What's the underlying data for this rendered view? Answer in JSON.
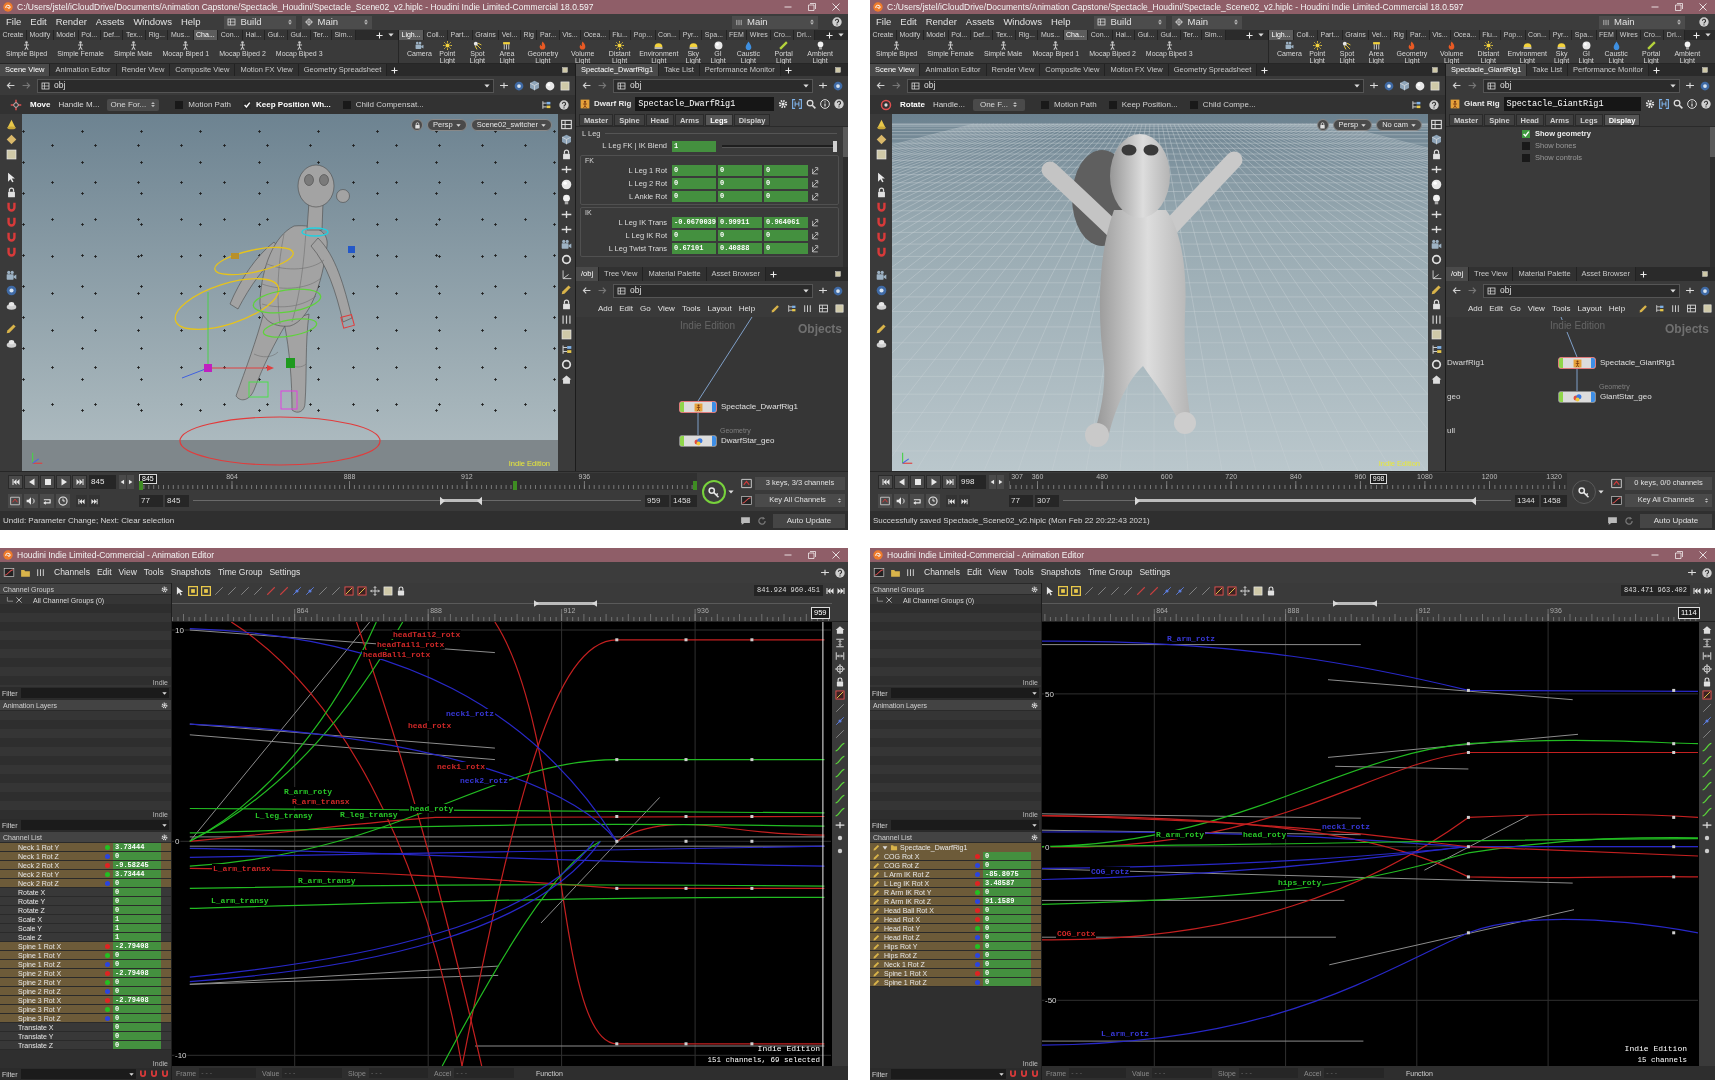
{
  "windows": [
    {
      "kind": "main",
      "title": "C:/Users/jstel/iCloudDrive/Documents/Animation Capstone/Spectacle_Houdini/Spectacle_Scene02_v2.hiplc - Houdini Indie Limited-Commercial 18.0.597",
      "menu": [
        "File",
        "Edit",
        "Render",
        "Assets",
        "Windows",
        "Help"
      ],
      "desk": "Build",
      "desktop": "Main",
      "right_desktop": "Main",
      "shelf_tabs_left": [
        {
          "label": "Create",
          "selected": false
        },
        {
          "label": "Modify",
          "selected": false
        },
        {
          "label": "Model",
          "selected": false
        },
        {
          "label": "Pol...",
          "selected": false
        },
        {
          "label": "Def...",
          "selected": false
        },
        {
          "label": "Tex...",
          "selected": false
        },
        {
          "label": "Rig...",
          "selected": false
        },
        {
          "label": "Mus...",
          "selected": false
        },
        {
          "label": "Cha...",
          "selected": true
        },
        {
          "label": "Con...",
          "selected": false
        },
        {
          "label": "Hai...",
          "selected": false
        },
        {
          "label": "Gui...",
          "selected": false
        },
        {
          "label": "Gui...",
          "selected": false
        },
        {
          "label": "Ter...",
          "selected": false
        },
        {
          "label": "Sim...",
          "selected": false
        }
      ],
      "shelf_tabs_right": [
        {
          "label": "Ligh...",
          "selected": true
        },
        {
          "label": "Coll...",
          "selected": false
        },
        {
          "label": "Part...",
          "selected": false
        },
        {
          "label": "Grains",
          "selected": false
        },
        {
          "label": "Vel...",
          "selected": false
        },
        {
          "label": "Rig",
          "selected": false
        },
        {
          "label": "Par...",
          "selected": false
        },
        {
          "label": "Vis...",
          "selected": false
        },
        {
          "label": "Ocea...",
          "selected": false
        },
        {
          "label": "Flu...",
          "selected": false
        },
        {
          "label": "Pop...",
          "selected": false
        },
        {
          "label": "Con...",
          "selected": false
        },
        {
          "label": "Pyr...",
          "selected": false
        },
        {
          "label": "Spa...",
          "selected": false
        },
        {
          "label": "FEM",
          "selected": false
        },
        {
          "label": "Wires",
          "selected": false
        },
        {
          "label": "Cro...",
          "selected": false
        },
        {
          "label": "Dri...",
          "selected": false
        }
      ],
      "shelf_tools_left": [
        {
          "label": "Simple Biped",
          "kind": "biped"
        },
        {
          "label": "Simple Female",
          "kind": "biped"
        },
        {
          "label": "Simple Male",
          "kind": "biped"
        },
        {
          "label": "Mocap Biped 1",
          "kind": "biped"
        },
        {
          "label": "Mocap Biped 2",
          "kind": "biped"
        },
        {
          "label": "Mocap Biped 3",
          "kind": "biped"
        }
      ],
      "shelf_tools_right": [
        {
          "label": "Camera",
          "kind": "camera"
        },
        {
          "label": "Point Light",
          "kind": "point_light"
        },
        {
          "label": "Spot Light",
          "kind": "spot_light"
        },
        {
          "label": "Area Light",
          "kind": "area_light"
        },
        {
          "label": "Geometry Light",
          "kind": "geometry_light"
        },
        {
          "label": "Volume Light",
          "kind": "volume_light"
        },
        {
          "label": "Distant Light",
          "kind": "distant_light"
        },
        {
          "label": "Environment Light",
          "kind": "environment_light"
        },
        {
          "label": "Sky Light",
          "kind": "sky_light"
        },
        {
          "label": "GI Light",
          "kind": "gi_light"
        },
        {
          "label": "Caustic Light",
          "kind": "caustic_light"
        },
        {
          "label": "Portal Light",
          "kind": "portal_light"
        },
        {
          "label": "Ambient Light",
          "kind": "ambient_light"
        }
      ],
      "view_tabs": [
        {
          "label": "Scene View",
          "selected": true
        },
        {
          "label": "Animation Editor",
          "selected": false
        },
        {
          "label": "Render View",
          "selected": false
        },
        {
          "label": "Composite View",
          "selected": false
        },
        {
          "label": "Motion FX View",
          "selected": false
        },
        {
          "label": "Geometry Spreadsheet",
          "selected": false
        }
      ],
      "param_tabs": [
        {
          "label": "Spectacle_DwarfRig1",
          "selected": true
        },
        {
          "label": "Take List",
          "selected": false
        },
        {
          "label": "Performance Monitor",
          "selected": false
        }
      ],
      "view_path": "obj",
      "param_path": "obj",
      "tool_options": {
        "kind": "move",
        "tool": "Move",
        "handle": "Handle M...",
        "mode": "One For...",
        "checks": [
          {
            "label": "Motion Path",
            "checked": false
          },
          {
            "label": "Keep Position Wh...",
            "checked": true
          },
          {
            "label": "Child Compensat...",
            "checked": false
          }
        ]
      },
      "viewport": {
        "kind": "dwarf",
        "camera": "Persp",
        "view": "Scene02_switcher",
        "watermark": "Indie Edition"
      },
      "parameters": {
        "type_label": "Dwarf Rig",
        "node_name": "Spectacle_DwarfRig1",
        "tabs": [
          {
            "label": "Master",
            "selected": false
          },
          {
            "label": "Spine",
            "selected": false
          },
          {
            "label": "Head",
            "selected": false
          },
          {
            "label": "Arms",
            "selected": false
          },
          {
            "label": "Legs",
            "selected": true
          },
          {
            "label": "Display",
            "selected": false
          }
        ],
        "content": [
          {
            "kind": "heading",
            "label": "L Leg"
          },
          {
            "kind": "slider",
            "label": "L Leg FK | IK Blend",
            "value": "1",
            "level": 1
          },
          {
            "kind": "group",
            "label": "FK",
            "children": [
              {
                "kind": "vector",
                "label": "L Leg 1 Rot",
                "values": [
                  "0",
                  "0",
                  "0"
                ]
              },
              {
                "kind": "vector",
                "label": "L Leg 2 Rot",
                "values": [
                  "0",
                  "0",
                  "0"
                ]
              },
              {
                "kind": "vector",
                "label": "L Ankle Rot",
                "values": [
                  "0",
                  "0",
                  "0"
                ]
              }
            ]
          },
          {
            "kind": "group",
            "label": "IK",
            "children": [
              {
                "kind": "vector",
                "label": "L Leg IK Trans",
                "values": [
                  "-0.0670039",
                  "0.99911",
                  "0.964061"
                ]
              },
              {
                "kind": "vector",
                "label": "L Leg IK Rot",
                "values": [
                  "0",
                  "0",
                  "0"
                ]
              },
              {
                "kind": "vector",
                "label": "L Leg Twist Trans",
                "values": [
                  "0.67101",
                  "0.40888",
                  "0"
                ]
              }
            ]
          }
        ]
      },
      "network_tabs": [
        {
          "label": "/obj",
          "selected": true
        },
        {
          "label": "Tree View",
          "selected": false
        },
        {
          "label": "Material Palette",
          "selected": false
        },
        {
          "label": "Asset Browser",
          "selected": false
        }
      ],
      "network_path": "obj",
      "network_menu": [
        "Add",
        "Edit",
        "Go",
        "View",
        "Tools",
        "Layout",
        "Help"
      ],
      "network": {
        "watermark": "Indie Edition",
        "context": "Objects",
        "nodes": [
          {
            "name": "Spectacle_DwarfRig1",
            "kind": "rig",
            "selected": true
          },
          {
            "name": "DwarfStar_geo",
            "kind": "geometry",
            "type_label": "Geometry",
            "selected": false
          }
        ]
      },
      "timeline": {
        "frame": "845",
        "ruler": [
          "864",
          "888",
          "912",
          "936"
        ],
        "current": "845",
        "range_start": "845",
        "range_end": "959",
        "start": "77",
        "end": "1458",
        "range_thumbs": [
          {
            "level": 0.556
          },
          {
            "level": 0.639
          }
        ],
        "keys": [
          {
            "level": 0
          },
          {
            "level": 0.67
          },
          {
            "level": 1
          }
        ],
        "key_active": true,
        "key_info": "3 keys, 3/3 channels",
        "key_mode": "Key All Channels"
      },
      "status": "Undid: Parameter Change; Next: Clear selection",
      "update_mode": "Auto Update"
    },
    {
      "kind": "main",
      "title": "C:/Users/jstel/iCloudDrive/Documents/Animation Capstone/Spectacle_Houdini/Spectacle_Scene02_v2.hiplc - Houdini Indie Limited-Commercial 18.0.597",
      "menu": [
        "File",
        "Edit",
        "Render",
        "Assets",
        "Windows",
        "Help"
      ],
      "desk": "Build",
      "desktop": "Main",
      "right_desktop": "Main",
      "shelf_tabs_left": [
        {
          "label": "Create",
          "selected": false
        },
        {
          "label": "Modify",
          "selected": false
        },
        {
          "label": "Model",
          "selected": false
        },
        {
          "label": "Pol...",
          "selected": false
        },
        {
          "label": "Def...",
          "selected": false
        },
        {
          "label": "Tex...",
          "selected": false
        },
        {
          "label": "Rig...",
          "selected": false
        },
        {
          "label": "Mus...",
          "selected": false
        },
        {
          "label": "Cha...",
          "selected": true
        },
        {
          "label": "Con...",
          "selected": false
        },
        {
          "label": "Hai...",
          "selected": false
        },
        {
          "label": "Gui...",
          "selected": false
        },
        {
          "label": "Gui...",
          "selected": false
        },
        {
          "label": "Ter...",
          "selected": false
        },
        {
          "label": "Sim...",
          "selected": false
        }
      ],
      "shelf_tabs_right": [
        {
          "label": "Ligh...",
          "selected": true
        },
        {
          "label": "Coll...",
          "selected": false
        },
        {
          "label": "Part...",
          "selected": false
        },
        {
          "label": "Grains",
          "selected": false
        },
        {
          "label": "Vel...",
          "selected": false
        },
        {
          "label": "Rig",
          "selected": false
        },
        {
          "label": "Par...",
          "selected": false
        },
        {
          "label": "Vis...",
          "selected": false
        },
        {
          "label": "Ocea...",
          "selected": false
        },
        {
          "label": "Flu...",
          "selected": false
        },
        {
          "label": "Pop...",
          "selected": false
        },
        {
          "label": "Con...",
          "selected": false
        },
        {
          "label": "Pyr...",
          "selected": false
        },
        {
          "label": "Spa...",
          "selected": false
        },
        {
          "label": "FEM",
          "selected": false
        },
        {
          "label": "Wires",
          "selected": false
        },
        {
          "label": "Cro...",
          "selected": false
        },
        {
          "label": "Dri...",
          "selected": false
        }
      ],
      "shelf_tools_left": [
        {
          "label": "Simple Biped",
          "kind": "biped"
        },
        {
          "label": "Simple Female",
          "kind": "biped"
        },
        {
          "label": "Simple Male",
          "kind": "biped"
        },
        {
          "label": "Mocap Biped 1",
          "kind": "biped"
        },
        {
          "label": "Mocap Biped 2",
          "kind": "biped"
        },
        {
          "label": "Mocap Biped 3",
          "kind": "biped"
        }
      ],
      "shelf_tools_right": [
        {
          "label": "Camera",
          "kind": "camera"
        },
        {
          "label": "Point Light",
          "kind": "point_light"
        },
        {
          "label": "Spot Light",
          "kind": "spot_light"
        },
        {
          "label": "Area Light",
          "kind": "area_light"
        },
        {
          "label": "Geometry Light",
          "kind": "geometry_light"
        },
        {
          "label": "Volume Light",
          "kind": "volume_light"
        },
        {
          "label": "Distant Light",
          "kind": "distant_light"
        },
        {
          "label": "Environment Light",
          "kind": "environment_light"
        },
        {
          "label": "Sky Light",
          "kind": "sky_light"
        },
        {
          "label": "GI Light",
          "kind": "gi_light"
        },
        {
          "label": "Caustic Light",
          "kind": "caustic_light"
        },
        {
          "label": "Portal Light",
          "kind": "portal_light"
        },
        {
          "label": "Ambient Light",
          "kind": "ambient_light"
        }
      ],
      "view_tabs": [
        {
          "label": "Scene View",
          "selected": true
        },
        {
          "label": "Animation Editor",
          "selected": false
        },
        {
          "label": "Render View",
          "selected": false
        },
        {
          "label": "Composite View",
          "selected": false
        },
        {
          "label": "Motion FX View",
          "selected": false
        },
        {
          "label": "Geometry Spreadsheet",
          "selected": false
        }
      ],
      "param_tabs": [
        {
          "label": "Spectacle_GiantRig1",
          "selected": true
        },
        {
          "label": "Take List",
          "selected": false
        },
        {
          "label": "Performance Monitor",
          "selected": false
        }
      ],
      "view_path": "obj",
      "param_path": "obj",
      "tool_options": {
        "kind": "rotate",
        "tool": "Rotate",
        "handle": "Handle...",
        "mode": "One F...",
        "checks": [
          {
            "label": "Motion Path",
            "checked": false
          },
          {
            "label": "Keep Position...",
            "checked": false
          },
          {
            "label": "Child Compe...",
            "checked": false
          }
        ]
      },
      "viewport": {
        "kind": "giant",
        "camera": "Persp",
        "view": "No cam",
        "watermark": "Indie Edition"
      },
      "parameters": {
        "type_label": "Giant Rig",
        "node_name": "Spectacle_GiantRig1",
        "tabs": [
          {
            "label": "Master",
            "selected": false
          },
          {
            "label": "Spine",
            "selected": false
          },
          {
            "label": "Head",
            "selected": false
          },
          {
            "label": "Arms",
            "selected": false
          },
          {
            "label": "Legs",
            "selected": false
          },
          {
            "label": "Display",
            "selected": true
          }
        ],
        "content": [
          {
            "kind": "checkbox",
            "label": "Show geometry",
            "checked": true,
            "disabled": false
          },
          {
            "kind": "checkbox",
            "label": "Show bones",
            "checked": false,
            "disabled": true
          },
          {
            "kind": "checkbox",
            "label": "Show controls",
            "checked": false,
            "disabled": true
          }
        ]
      },
      "network_tabs": [
        {
          "label": "/obj",
          "selected": true
        },
        {
          "label": "Tree View",
          "selected": false
        },
        {
          "label": "Material Palette",
          "selected": false
        },
        {
          "label": "Asset Browser",
          "selected": false
        }
      ],
      "network_path": "obj",
      "network_menu": [
        "Add",
        "Edit",
        "Go",
        "View",
        "Tools",
        "Layout",
        "Help"
      ],
      "network": {
        "watermark": "Indie Edition",
        "context": "Objects",
        "partial_nodes": [
          "DwarfRig1",
          "geo",
          "ull"
        ],
        "nodes": [
          {
            "name": "Spectacle_GiantRig1",
            "kind": "rig",
            "selected": true
          },
          {
            "name": "GiantStar_geo",
            "kind": "geometry",
            "type_label": "Geometry",
            "selected": false
          }
        ]
      },
      "timeline": {
        "frame": "998",
        "ruler": [
          "307",
          "360",
          "480",
          "600",
          "720",
          "840",
          "960",
          "1080",
          "1200",
          "1320"
        ],
        "current": "998",
        "range_start": "307",
        "range_end": "1344",
        "start": "77",
        "end": "1458",
        "range_thumbs": [
          {
            "level": 0.167
          },
          {
            "level": 0.917
          }
        ],
        "key_active": false,
        "key_info": "0 keys, 0/0 channels",
        "key_mode": "Key All Channels"
      },
      "status": "Successfully saved Spectacle_Scene02_v2.hiplc (Mon Feb 22 20:22:43 2021)",
      "update_mode": "Auto Update"
    },
    {
      "kind": "animation_editor",
      "title": "Houdini Indie Limited-Commercial - Animation Editor",
      "menu": [
        "Channels",
        "Edit",
        "View",
        "Tools",
        "Snapshots",
        "Time Group",
        "Settings"
      ],
      "channel_groups": {
        "title": "Channel Groups",
        "items": [
          "All Channel Groups (0)"
        ],
        "corner_label": "Indie",
        "filter_label": "Filter"
      },
      "animation_layers": {
        "title": "Animation Layers",
        "corner_label": "Indie",
        "filter_label": "Filter"
      },
      "channel_list": {
        "title": "Channel List",
        "rows": [
          {
            "name": "Neck 1 Rot Y",
            "value": "3.73444",
            "selected": true,
            "color": "#22c022"
          },
          {
            "name": "Neck 1 Rot Z",
            "value": "0",
            "selected": true,
            "color": "#2a44e0"
          },
          {
            "name": "Neck 2 Rot X",
            "value": "-9.58245",
            "selected": true,
            "color": "#e02222"
          },
          {
            "name": "Neck 2 Rot Y",
            "value": "3.73444",
            "selected": true,
            "color": "#22c022"
          },
          {
            "name": "Neck 2 Rot Z",
            "value": "0",
            "selected": true,
            "color": "#2a44e0"
          },
          {
            "name": "Rotate X",
            "value": "0",
            "selected": false
          },
          {
            "name": "Rotate Y",
            "value": "0",
            "selected": false
          },
          {
            "name": "Rotate Z",
            "value": "0",
            "selected": false
          },
          {
            "name": "Scale X",
            "value": "1",
            "selected": false
          },
          {
            "name": "Scale Y",
            "value": "1",
            "selected": false
          },
          {
            "name": "Scale Z",
            "value": "1",
            "selected": false
          },
          {
            "name": "Spine 1 Rot X",
            "value": "-2.79408",
            "selected": true,
            "color": "#e02222"
          },
          {
            "name": "Spine 1 Rot Y",
            "value": "0",
            "selected": true,
            "color": "#22c022"
          },
          {
            "name": "Spine 1 Rot Z",
            "value": "0",
            "selected": true,
            "color": "#2a44e0"
          },
          {
            "name": "Spine 2 Rot X",
            "value": "-2.79408",
            "selected": true,
            "color": "#e02222"
          },
          {
            "name": "Spine 2 Rot Y",
            "value": "0",
            "selected": true,
            "color": "#22c022"
          },
          {
            "name": "Spine 2 Rot Z",
            "value": "0",
            "selected": true,
            "color": "#2a44e0"
          },
          {
            "name": "Spine 3 Rot X",
            "value": "-2.79408",
            "selected": true,
            "color": "#e02222"
          },
          {
            "name": "Spine 3 Rot Y",
            "value": "0",
            "selected": true,
            "color": "#22c022"
          },
          {
            "name": "Spine 3 Rot Z",
            "value": "0",
            "selected": true,
            "color": "#2a44e0"
          },
          {
            "name": "Translate X",
            "value": "0",
            "selected": false
          },
          {
            "name": "Translate Y",
            "value": "0",
            "selected": false
          },
          {
            "name": "Translate Z",
            "value": "0",
            "selected": false
          }
        ],
        "corner_label": "Indie",
        "filter_label": "Filter"
      },
      "graph": {
        "kind": "dwarf",
        "readout": "841.924 960.451",
        "range_thumbs": [
          {
            "level": 0.553
          },
          {
            "level": 0.64
          }
        ],
        "ruler": [
          "864",
          "888",
          "912",
          "936"
        ],
        "current_frame": "959",
        "y_labels": [
          "10",
          "0",
          "-10"
        ],
        "curve_labels": [
          {
            "text": "headTail2_rotx",
            "color": "#d02828"
          },
          {
            "text": "headTail1_rotx",
            "color": "#d02828"
          },
          {
            "text": "headBall1_rotx",
            "color": "#d02828"
          },
          {
            "text": "neck1_rotz",
            "color": "#3838d8"
          },
          {
            "text": "head_rotx",
            "color": "#d02828"
          },
          {
            "text": "neck1_rotx",
            "color": "#d02828"
          },
          {
            "text": "neck2_rotz",
            "color": "#3838d8"
          },
          {
            "text": "R_arm_roty",
            "color": "#28c828"
          },
          {
            "text": "R_arm_transx",
            "color": "#d02828"
          },
          {
            "text": "L_leg_transy",
            "color": "#28c828"
          },
          {
            "text": "R_leg_transy",
            "color": "#28c828"
          },
          {
            "text": "head_roty",
            "color": "#28c828"
          },
          {
            "text": "L_arm_transx",
            "color": "#d02828"
          },
          {
            "text": "R_arm_transy",
            "color": "#28c828"
          },
          {
            "text": "L_arm_transy",
            "color": "#28c828"
          }
        ],
        "watermark": "Indie Edition",
        "summary": "151 channels, 69 selected"
      },
      "fields": [
        {
          "label": "Frame",
          "value": "- - -"
        },
        {
          "label": "Value",
          "value": "- - -"
        },
        {
          "label": "Slope",
          "value": "- - -"
        },
        {
          "label": "Accel",
          "value": "- - -"
        },
        {
          "label": "Function"
        }
      ]
    },
    {
      "kind": "animation_editor",
      "title": "Houdini Indie Limited-Commercial - Animation Editor",
      "menu": [
        "Channels",
        "Edit",
        "View",
        "Tools",
        "Snapshots",
        "Time Group",
        "Settings"
      ],
      "channel_groups": {
        "title": "Channel Groups",
        "items": [
          "All Channel Groups (0)"
        ],
        "corner_label": "Indie",
        "filter_label": "Filter"
      },
      "animation_layers": {
        "title": "Animation Layers",
        "corner_label": "Indie",
        "filter_label": "Filter"
      },
      "channel_list": {
        "title": "Channel List",
        "root": {
          "label": "Spectacle_DwarfRig1",
          "expanded": true
        },
        "rows": [
          {
            "name": "COG Rot X",
            "value": "0",
            "selected": true,
            "color": "#e02222"
          },
          {
            "name": "COG Rot Z",
            "value": "0",
            "selected": true,
            "color": "#2a44e0"
          },
          {
            "name": "L Arm IK Rot Z",
            "value": "-85.8075",
            "selected": true,
            "color": "#2a44e0"
          },
          {
            "name": "L Leg IK Rot X",
            "value": "3.48587",
            "selected": true,
            "color": "#e02222"
          },
          {
            "name": "R Arm IK Rot Y",
            "value": "0",
            "selected": true,
            "color": "#22c022"
          },
          {
            "name": "R Arm IK Rot Z",
            "value": "91.1589",
            "selected": true,
            "color": "#2a44e0"
          },
          {
            "name": "Head Ball Rot X",
            "value": "0",
            "selected": true,
            "color": "#e02222"
          },
          {
            "name": "Head Rot X",
            "value": "0",
            "selected": true,
            "color": "#e02222"
          },
          {
            "name": "Head Rot Y",
            "value": "0",
            "selected": true,
            "color": "#22c022"
          },
          {
            "name": "Head Rot Z",
            "value": "0",
            "selected": true,
            "color": "#2a44e0"
          },
          {
            "name": "Hips Rot Y",
            "value": "0",
            "selected": true,
            "color": "#22c022"
          },
          {
            "name": "Hips Rot Z",
            "value": "0",
            "selected": true,
            "color": "#2a44e0"
          },
          {
            "name": "Neck 1 Rot Z",
            "value": "0",
            "selected": true,
            "color": "#2a44e0"
          },
          {
            "name": "Spine 1 Rot X",
            "value": "0",
            "selected": true,
            "color": "#e02222"
          },
          {
            "name": "Spine 1 Rot Z",
            "value": "0",
            "selected": true,
            "color": "#2a44e0"
          }
        ],
        "corner_label": "Indie",
        "filter_label": "Filter"
      },
      "graph": {
        "kind": "giant",
        "readout": "843.471 963.402",
        "range_thumbs": [
          {
            "level": 0.446
          },
          {
            "level": 0.506
          }
        ],
        "ruler": [
          "864",
          "888",
          "912",
          "936"
        ],
        "current_frame": "1114",
        "y_labels": [
          "50",
          "0",
          "-50"
        ],
        "curve_labels": [
          {
            "text": "R_arm_rotz",
            "color": "#3838d8"
          },
          {
            "text": "neck1_rotz",
            "color": "#3838d8"
          },
          {
            "text": "R_arm_roty",
            "color": "#28c828"
          },
          {
            "text": "head_roty",
            "color": "#28c828"
          },
          {
            "text": "COG_rotz",
            "color": "#3838d8"
          },
          {
            "text": "hips_roty",
            "color": "#28c828"
          },
          {
            "text": "COG_rotx",
            "color": "#d02828"
          },
          {
            "text": "L_arm_rotz",
            "color": "#3838d8"
          }
        ],
        "watermark": "Indie Edition",
        "summary": "15 channels"
      },
      "fields": [
        {
          "label": "Frame",
          "value": "- - -"
        },
        {
          "label": "Value",
          "value": "- - -"
        },
        {
          "label": "Slope",
          "value": "- - -"
        },
        {
          "label": "Accel",
          "value": "- - -"
        },
        {
          "label": "Function"
        }
      ]
    }
  ]
}
